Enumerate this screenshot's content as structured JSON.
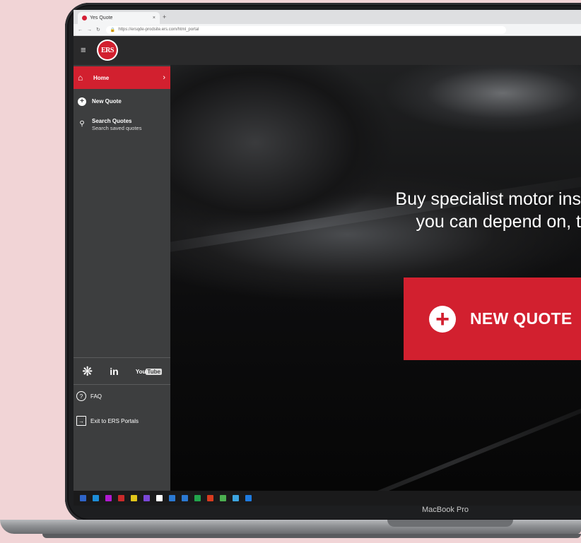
{
  "browser": {
    "tab_title": "Yes Quote",
    "tab_close": "×",
    "new_tab": "+",
    "url": "https://ersqde-prodsite.ers.com/html_portal"
  },
  "header": {
    "menu_icon": "hamburger-icon",
    "logo_text": "ERS"
  },
  "sidebar": {
    "home": {
      "label": "Home",
      "icon": "home-icon"
    },
    "new_quote": {
      "label": "New Quote",
      "icon": "plus-circle-icon"
    },
    "search_quotes": {
      "label": "Search Quotes",
      "sublabel": "Search saved quotes",
      "icon": "search-icon"
    },
    "social": {
      "linkedin": "in",
      "youtube_a": "You",
      "youtube_b": "Tube"
    },
    "faq": {
      "label": "FAQ",
      "icon": "question-circle-icon"
    },
    "exit": {
      "label": "Exit to ERS Portals",
      "icon": "exit-icon"
    }
  },
  "hero": {
    "line1": "Buy specialist motor ins",
    "line2": "you can depend on, t",
    "cta_label": "NEW QUOTE"
  },
  "taskbar": {
    "icons": [
      "#2f64c8",
      "#1d8dd8",
      "#b11ad1",
      "#c92a2a",
      "#e0c51a",
      "#7a47d6",
      "#ffffff",
      "#2b79d2",
      "#2b79d2",
      "#22a44c",
      "#d83b1f",
      "#4caf50",
      "#3da5e0",
      "#1e7be0"
    ]
  },
  "device": {
    "label": "MacBook Pro"
  },
  "colors": {
    "brand_red": "#d2202f",
    "sidebar_bg": "#3d3e3f",
    "header_bg": "#2a2a2b"
  }
}
